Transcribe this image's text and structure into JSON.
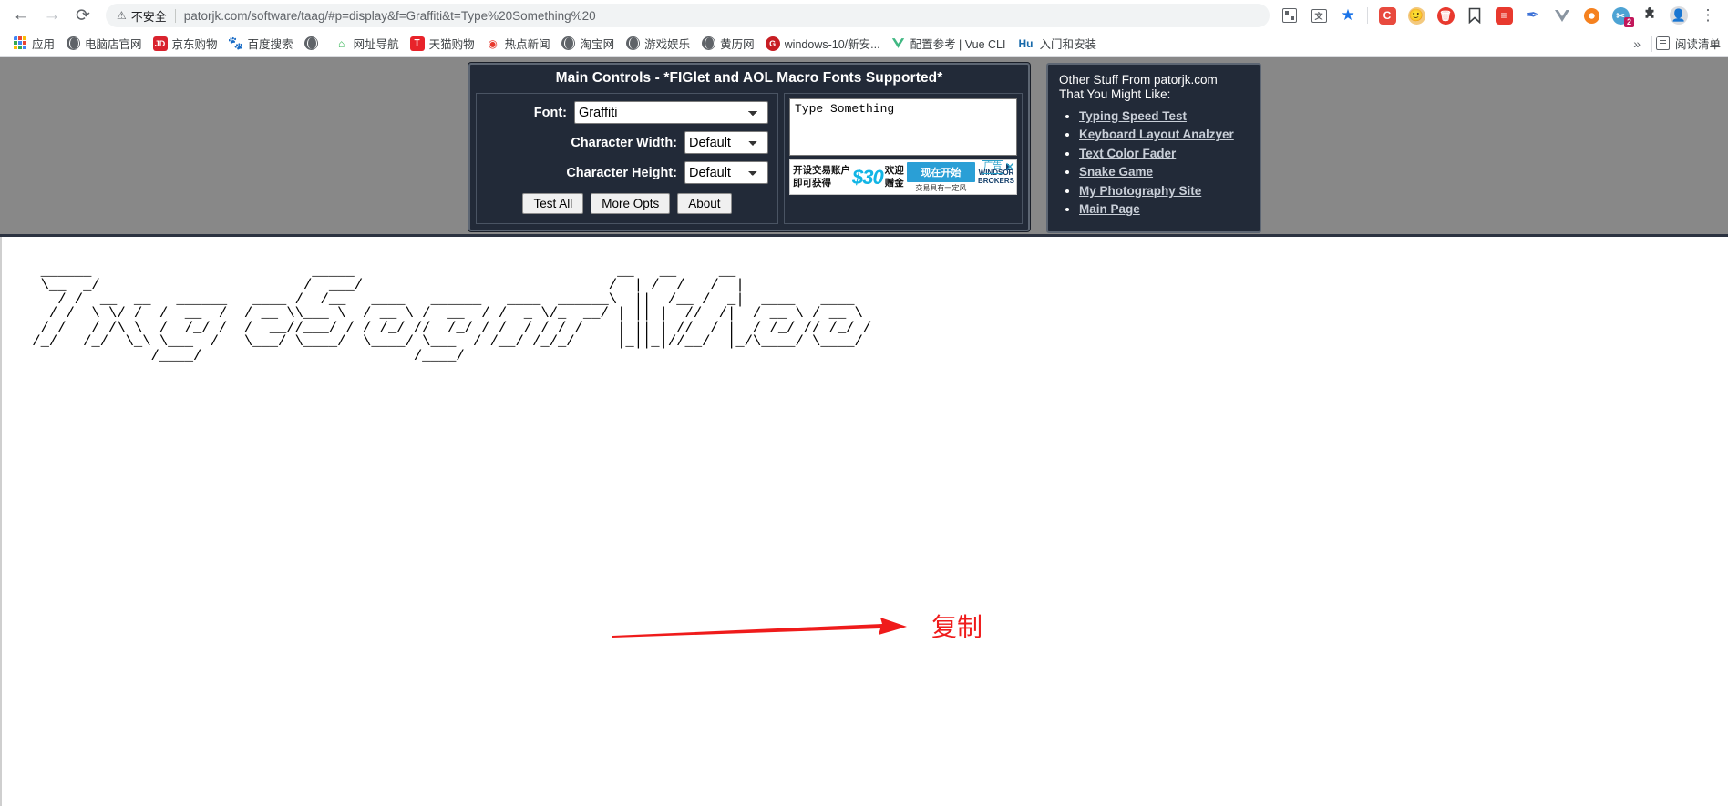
{
  "browser": {
    "nav": {
      "back": "←",
      "forward": "→",
      "reload": "⟳"
    },
    "omnibox": {
      "security_warning": "不安全",
      "url": "patorjk.com/software/taag/#p=display&f=Graffiti&t=Type%20Something%20"
    },
    "toolbar_icons": [
      {
        "name": "qr-code-icon",
        "glyph": ""
      },
      {
        "name": "translate-icon",
        "glyph": "文"
      },
      {
        "name": "bookmark-star-icon",
        "glyph": "★"
      },
      {
        "name": "extension-c-icon",
        "glyph": "C",
        "color": "#e84a3e"
      },
      {
        "name": "extension-avatar-icon",
        "glyph": "🙂",
        "color": "#f5c26b"
      },
      {
        "name": "extension-trash-icon",
        "glyph": "",
        "color": "#e8392e"
      },
      {
        "name": "pocket-bookmark-icon",
        "glyph": "",
        "color": "#3c4043"
      },
      {
        "name": "extension-notes-icon",
        "glyph": "",
        "color": "#e8392e"
      },
      {
        "name": "extension-pen-icon",
        "glyph": "✒",
        "color": "#3d72d7"
      },
      {
        "name": "vue-devtools-icon",
        "glyph": "V",
        "color": "#7f8b99"
      },
      {
        "name": "extension-color-ring-icon",
        "glyph": "",
        "color": "#f5811f"
      },
      {
        "name": "extension-scissors-icon",
        "glyph": "✂",
        "color": "#4da3d4",
        "badge": "2"
      },
      {
        "name": "extensions-puzzle-icon",
        "glyph": "",
        "color": "#3c4043"
      },
      {
        "name": "profile-avatar-icon",
        "glyph": "",
        "color": "#5f6368"
      },
      {
        "name": "chrome-menu-icon",
        "glyph": "⋮"
      }
    ],
    "bookmarks": [
      {
        "label": "应用",
        "icon": "apps-grid-icon"
      },
      {
        "label": "电脑店官网",
        "icon": "globe-icon"
      },
      {
        "label": "京东购物",
        "icon": "jd-icon"
      },
      {
        "label": "百度搜索",
        "icon": "baidu-icon"
      },
      {
        "label": "",
        "icon": "globe-icon"
      },
      {
        "label": "网址导航",
        "icon": "nav-2345-icon"
      },
      {
        "label": "天猫购物",
        "icon": "tmall-icon"
      },
      {
        "label": "热点新闻",
        "icon": "news-flame-icon"
      },
      {
        "label": "淘宝网",
        "icon": "globe-icon"
      },
      {
        "label": "游戏娱乐",
        "icon": "globe-icon"
      },
      {
        "label": "黄历网",
        "icon": "globe-icon"
      },
      {
        "label": "windows-10/新安...",
        "icon": "gitee-icon"
      },
      {
        "label": "配置参考 | Vue CLI",
        "icon": "vue-icon"
      },
      {
        "label": "入门和安装",
        "icon": "hu-icon"
      }
    ],
    "bookmarks_overflow": "»",
    "reading_list": "阅读清单"
  },
  "main_controls": {
    "title": "Main Controls - *FIGlet and AOL Macro Fonts Supported*",
    "font_label": "Font:",
    "font_value": "Graffiti",
    "font_options": [
      "Graffiti"
    ],
    "char_width_label": "Character Width:",
    "char_width_value": "Default",
    "char_width_options": [
      "Default"
    ],
    "char_height_label": "Character Height:",
    "char_height_value": "Default",
    "char_height_options": [
      "Default"
    ],
    "buttons": {
      "test_all": "Test All",
      "more_opts": "More Opts",
      "about": "About"
    },
    "textarea_value": "Type Something"
  },
  "ad": {
    "line1": "开设交易账户",
    "line2": "即可获得",
    "amount": "$30",
    "welcome1": "欢迎",
    "welcome2": "赠金",
    "cta": "现在开始",
    "disclaimer": "交易具有一定风",
    "brand_line1": "WINDSOR",
    "brand_line2": "BROKERS",
    "ad_label": "广告",
    "close": "✕"
  },
  "other_stuff": {
    "title_line1": "Other Stuff From patorjk.com",
    "title_line2": "That You Might Like:",
    "links": [
      "Typing Speed Test",
      "Keyboard Layout Analzyer",
      "Text Color Fader",
      "Snake Game",
      "My Photography Site",
      "Main Page"
    ]
  },
  "output": {
    "ascii_art": "  ______                          _____                               __   __     __                \n  \\__  _/                        /  ___/                             /  | /  /   /  |               \n    / /  __  __   ______   ____ /  /__   ____   ______   ____  ______\\  ||  /__ /  _|  ____   ____  \n   / /  \\ \\/ /  /  __  /  / __ \\\\___ \\  / __ \\ /  __  / /  _ \\/_  __/ | || |  //  /|  / __ \\ / __ \\ \n  / /   / /\\ \\  /  /_/ /  /  __//___/ / / /_/ //  /_/ / /  / / / /    | || | //  / |  / /_/ // /_/ /\n /_/   /_/  \\_\\ \\___  /   \\___/ \\____/  \\____/ \\___  / /__/ /_/_/     |_||_|//__/  |_/\\____/ \\____/ \n               /____/                         /____/                                               "
  },
  "annotation": {
    "text": "复制",
    "color": "#ef1b1b"
  }
}
